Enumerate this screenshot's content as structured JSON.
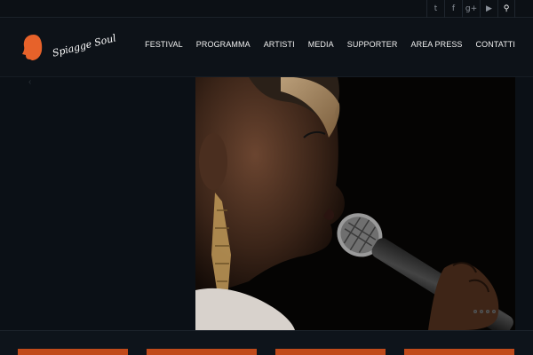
{
  "social": {
    "icons": [
      "twitter-icon",
      "facebook-icon",
      "google-plus-icon",
      "youtube-icon",
      "search-icon"
    ],
    "glyphs": [
      "t",
      "f",
      "g+",
      "▶",
      "⚲"
    ]
  },
  "logo": {
    "text": "Spiagge Soul",
    "color": "#e7622a"
  },
  "nav": {
    "items": [
      "FESTIVAL",
      "PROGRAMMA",
      "ARTISTI",
      "MEDIA",
      "SUPPORTER",
      "AREA PRESS",
      "CONTATTI"
    ]
  },
  "slider": {
    "prev_glyph": "‹",
    "next_glyph": "›",
    "dots": 4
  },
  "colors": {
    "accent": "#c14a1a",
    "background": "#0d1117"
  }
}
